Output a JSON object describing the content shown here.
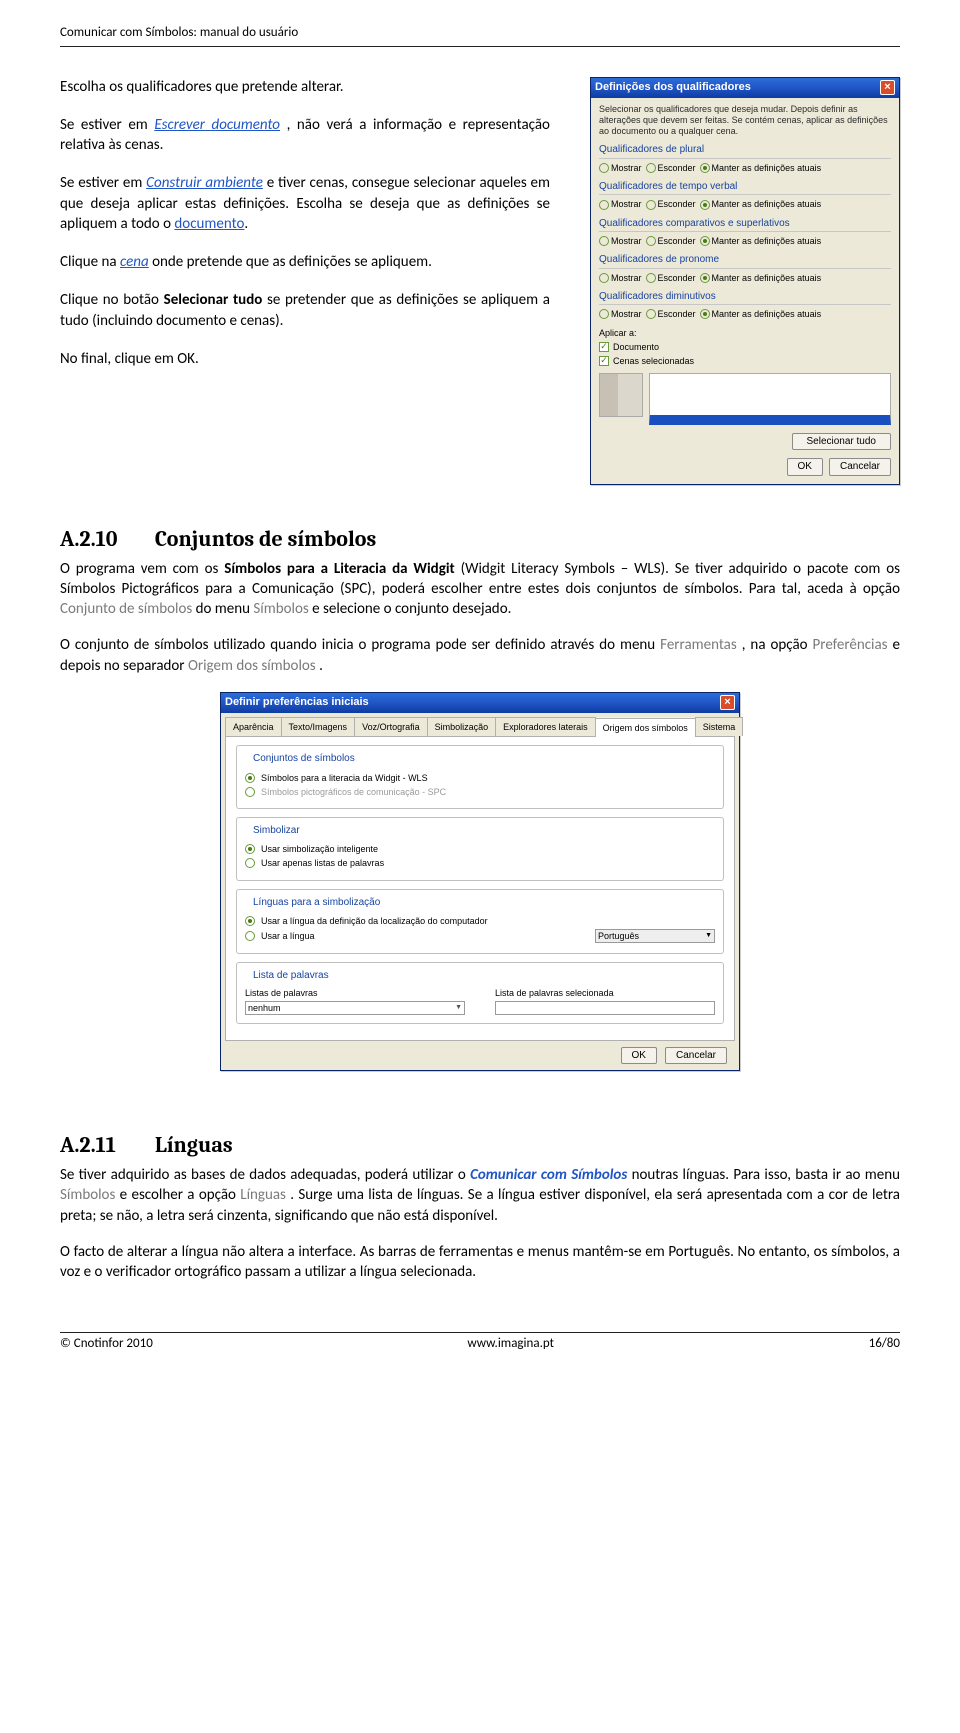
{
  "header": "Comunicar com Símbolos: manual do usuário",
  "left": {
    "p1a": "Escolha os qualificadores que pretende alterar.",
    "p2a": "Se estiver em ",
    "p2link": "Escrever documento",
    "p2b": ", não verá a informação e representação relativa às cenas.",
    "p3a": "Se estiver em ",
    "p3link": "Construir ambiente",
    "p3b": " e tiver cenas, consegue selecionar aqueles em que deseja aplicar estas definições. Escolha se deseja que as definições se apliquem a todo o ",
    "p3link2": "documento",
    "p3c": ".",
    "p4a": "Clique na ",
    "p4link": "cena",
    "p4b": " onde pretende que as definições se apliquem.",
    "p5a": "Clique no botão ",
    "p5b": "Selecionar tudo",
    "p5c": " se pretender que as definições se apliquem a tudo (incluindo documento e cenas).",
    "p6": "No final, clique em OK."
  },
  "dialog1": {
    "title": "Definições dos qualificadores",
    "intro": "Selecionar os qualificadores que deseja mudar. Depois definir as alterações que devem ser feitas. Se contém cenas, aplicar as definições ao documento ou a qualquer cena.",
    "sections": [
      "Qualificadores de plural",
      "Qualificadores de tempo verbal",
      "Qualificadores comparativos e superlativos",
      "Qualificadores de pronome",
      "Qualificadores diminutivos"
    ],
    "opts": [
      "Mostrar",
      "Esconder",
      "Manter as definições atuais"
    ],
    "applyLabel": "Aplicar a:",
    "chk1": "Documento",
    "chk2": "Cenas selecionadas",
    "btnSelAll": "Selecionar tudo",
    "btnOk": "OK",
    "btnCancel": "Cancelar"
  },
  "secA": {
    "num": "A.2.10",
    "title": "Conjuntos de símbolos",
    "p1a": "O programa vem com os ",
    "p1b": "Símbolos para a Literacia da Widgit",
    "p1c": " (Widgit Literacy Symbols – WLS). Se tiver adquirido o pacote com os Símbolos Pictográficos para a Comunicação (SPC), poderá escolher entre estes dois conjuntos de símbolos. Para tal, aceda à opção ",
    "p1d": "Conjunto de símbolos",
    "p1e": " do menu ",
    "p1f": "Símbolos",
    "p1g": " e selecione o conjunto desejado.",
    "p2a": "O conjunto de símbolos utilizado quando inicia o programa pode ser definido através do menu ",
    "p2b": "Ferramentas",
    "p2c": ", na opção ",
    "p2d": "Preferências",
    "p2e": " e depois no separador ",
    "p2f": "Origem dos símbolos",
    "p2g": "."
  },
  "dialog2": {
    "title": "Definir preferências iniciais",
    "tabs": [
      "Aparência",
      "Texto/Imagens",
      "Voz/Ortografia",
      "Simbolização",
      "Exploradores laterais",
      "Origem dos símbolos",
      "Sistema"
    ],
    "activeTab": 5,
    "fs1": {
      "legend": "Conjuntos de símbolos",
      "opt1": "Símbolos para a literacia da Widgit - WLS",
      "opt2": "Símbolos pictográficos de comunicação - SPC"
    },
    "fs2": {
      "legend": "Simbolizar",
      "opt1": "Usar simbolização inteligente",
      "opt2": "Usar apenas listas de palavras"
    },
    "fs3": {
      "legend": "Línguas para a simbolização",
      "opt1": "Usar a língua da definição da localização do computador",
      "opt2": "Usar a língua",
      "select": "Português"
    },
    "fs4": {
      "legend": "Lista de palavras",
      "lbl1": "Listas de palavras",
      "lbl2": "Lista de palavras selecionada",
      "val1": "nenhum"
    },
    "btnOk": "OK",
    "btnCancel": "Cancelar"
  },
  "secB": {
    "num": "A.2.11",
    "title": "Línguas",
    "p1a": "Se tiver adquirido as bases de dados adequadas, poderá utilizar o ",
    "p1prod": "Comunicar com Símbolos",
    "p1b": " noutras línguas. Para isso, basta ir ao menu ",
    "p1c": "Símbolos",
    "p1d": " e escolher a opção ",
    "p1e": "Línguas",
    "p1f": ". Surge uma lista de línguas. Se a língua estiver disponível, ela será apresentada com a cor de letra preta; se não, a letra será cinzenta, significando que não está disponível.",
    "p2": "O facto de alterar a língua não altera a interface. As barras de ferramentas e menus mantêm-se em Português. No entanto, os símbolos, a voz e o verificador ortográfico passam a utilizar a língua selecionada."
  },
  "footer": {
    "left": "© Cnotinfor 2010",
    "mid": "www.imagina.pt",
    "right": "16/80"
  }
}
